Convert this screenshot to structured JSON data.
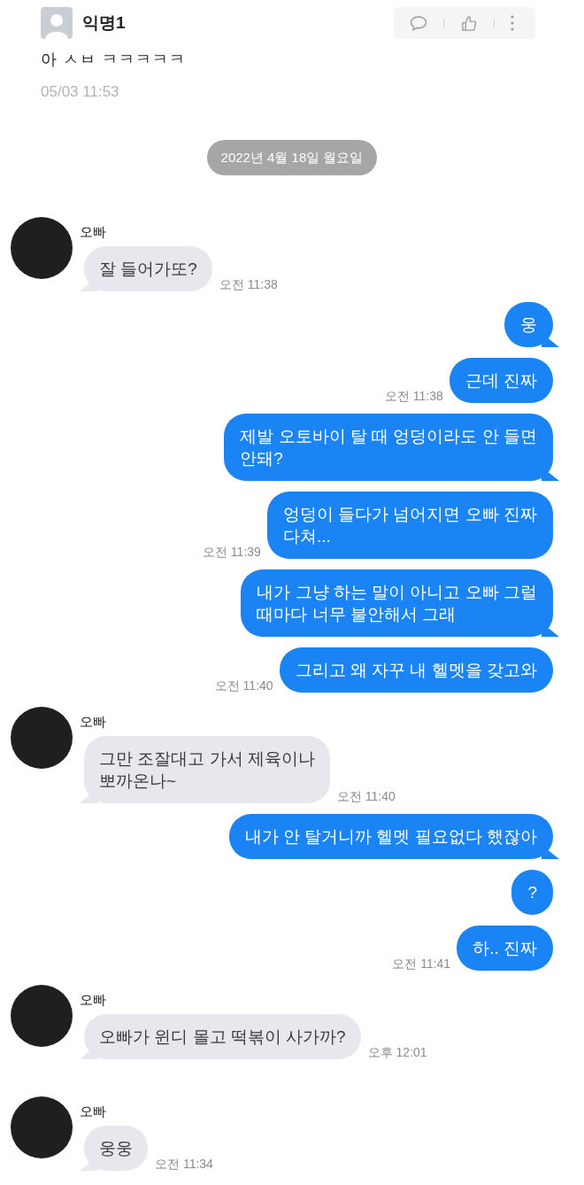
{
  "post": {
    "author": "익명1",
    "text": "아 ㅅㅂ ㅋㅋㅋㅋㅋ",
    "timestamp": "05/03 11:53"
  },
  "chat": {
    "date_chip": "2022년 4월 18일 월요일",
    "messages": [
      {
        "kind": "received",
        "sender": "오빠",
        "text": "잘 들어가또?",
        "time": "오전 11:38",
        "tail": true
      },
      {
        "kind": "sent",
        "text": "웅",
        "tail": true
      },
      {
        "kind": "sent",
        "text": "근데 진짜",
        "time": "오전 11:38",
        "tail": false
      },
      {
        "kind": "sent",
        "text": "제발 오토바이 탈 때 엉덩이라도 안 들면\n안돼?",
        "tail": true
      },
      {
        "kind": "sent",
        "text": "엉덩이 들다가 넘어지면 오빠 진짜\n다쳐...",
        "time": "오전 11:39",
        "tail": false
      },
      {
        "kind": "sent",
        "text": "내가 그냥 하는 말이 아니고 오빠 그럴\n때마다 너무 불안해서 그래",
        "tail": true
      },
      {
        "kind": "sent",
        "text": "그리고 왜 자꾸 내 헬멧을 갖고와",
        "time": "오전 11:40",
        "tail": false
      },
      {
        "kind": "received",
        "sender": "오빠",
        "text": "그만 조잘대고 가서 제육이나\n뽀까온나~",
        "time": "오전 11:40",
        "tail": true
      },
      {
        "kind": "sent",
        "text": "내가 안 탈거니까 헬멧 필요없다 했잖아",
        "tail": true
      },
      {
        "kind": "sent",
        "text": "?",
        "tail": false
      },
      {
        "kind": "sent",
        "text": "하.. 진짜",
        "time": "오전 11:41",
        "tail": false
      },
      {
        "kind": "received",
        "sender": "오빠",
        "text": "오빠가 윈디 몰고 떡볶이 사가까?",
        "time": "오후 12:01",
        "tail": true
      },
      {
        "kind": "received",
        "sender": "오빠",
        "text": "웅웅",
        "time": "오전 11:34",
        "tail": true
      }
    ]
  }
}
